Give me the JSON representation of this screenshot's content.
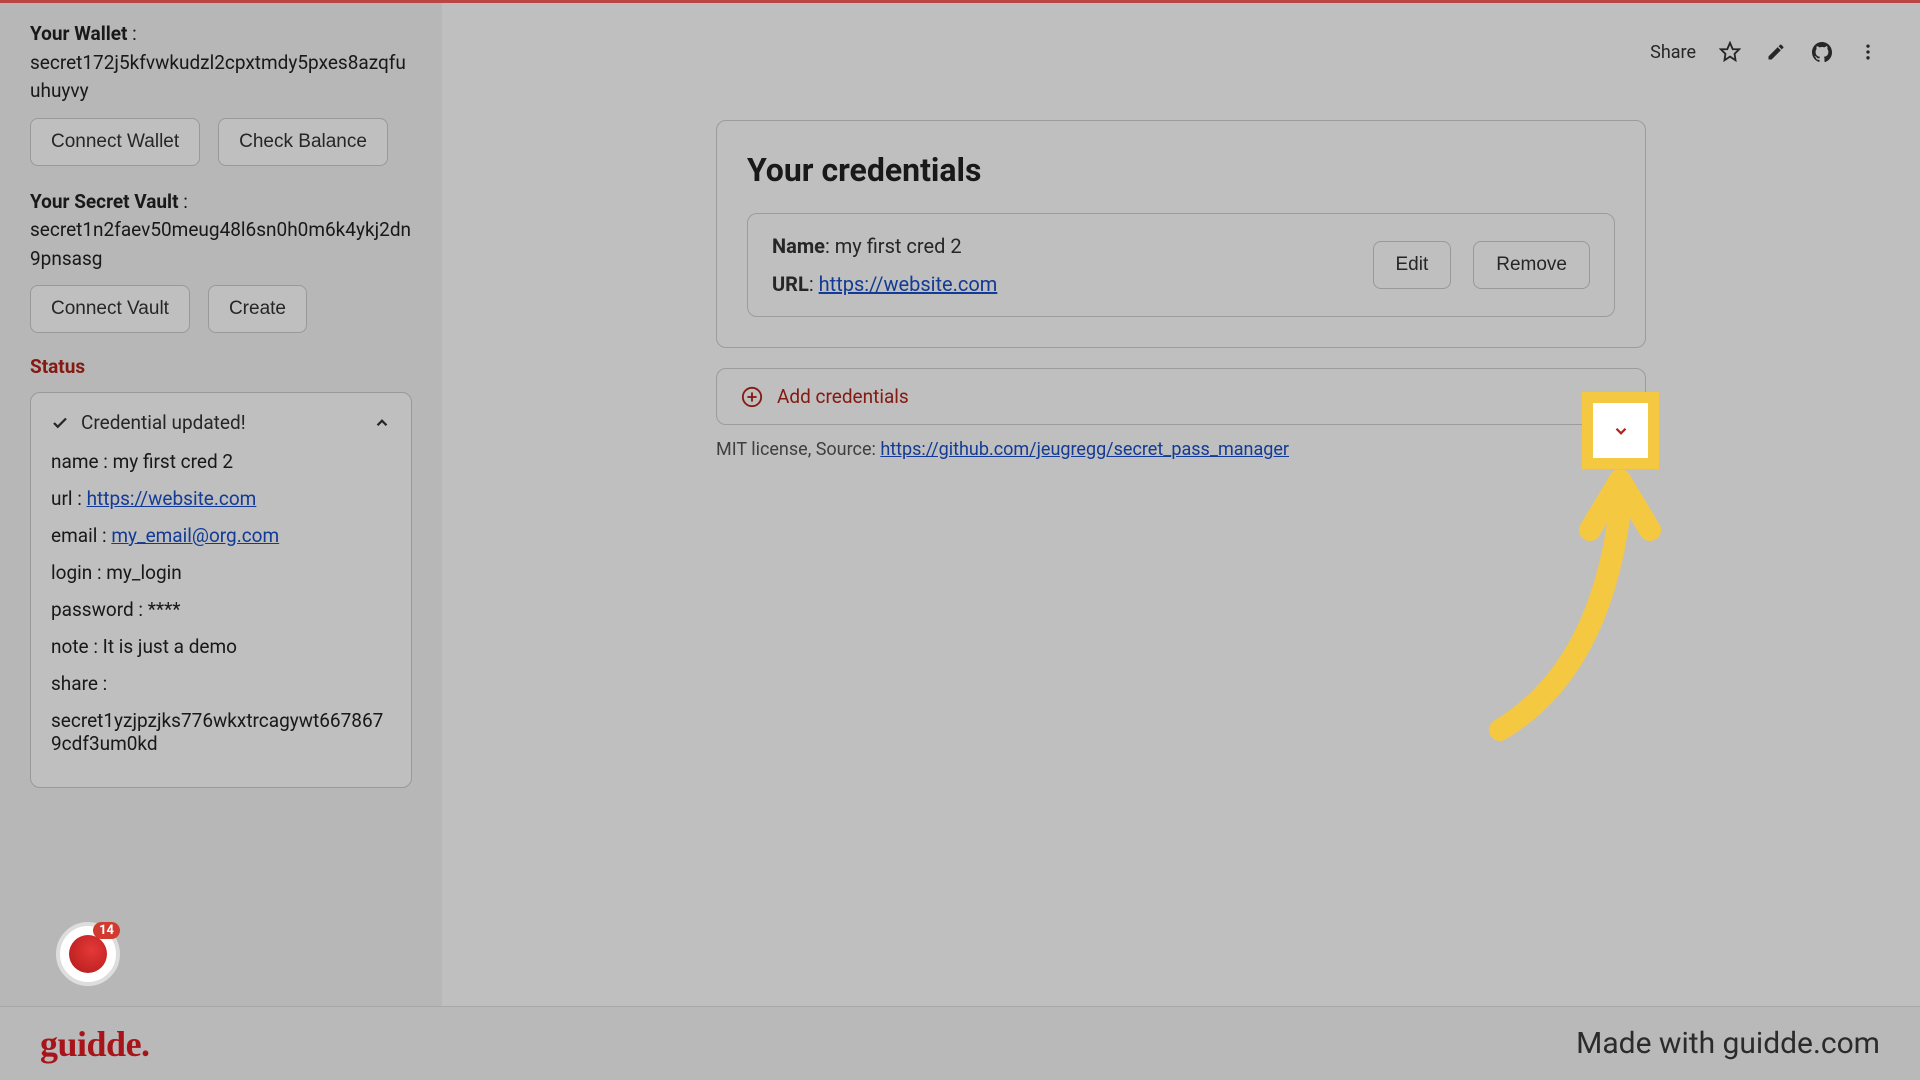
{
  "sidebar": {
    "wallet_label": "Your Wallet",
    "wallet_value": "secret172j5kfvwkudzl2cpxtmdy5pxes8azqfuuhuyvy",
    "connect_wallet": "Connect Wallet",
    "check_balance": "Check Balance",
    "vault_label": "Your Secret Vault",
    "vault_value": "secret1n2faev50meug48l6sn0h0m6k4ykj2dn9pnsasg",
    "connect_vault": "Connect Vault",
    "create": "Create",
    "status_title": "Status",
    "status_header": "Credential updated!",
    "details": {
      "name_label": "name : ",
      "name_value": "my first cred 2",
      "url_label": "url : ",
      "url_value": "https://website.com",
      "email_label": "email : ",
      "email_value": "my_email@org.com",
      "login_label": "login : ",
      "login_value": "my_login",
      "password_label": "password : ",
      "password_value": "****",
      "note_label": "note : ",
      "note_value": "It is just a demo",
      "share_label": "share :",
      "share_value": "secret1yzjpzjks776wkxtrcagywt6678679cdf3um0kd"
    },
    "badge_count": "14"
  },
  "top": {
    "share": "Share"
  },
  "main": {
    "title": "Your credentials",
    "item_name_label": "Name",
    "item_name_value": ": my first cred 2",
    "item_url_label": "URL",
    "item_url_sep": ": ",
    "item_url_value": "https://website.com",
    "edit": "Edit",
    "remove": "Remove",
    "add": "Add credentials",
    "footer_prefix": "MIT license, Source: ",
    "footer_link": "https://github.com/jeugregg/secret_pass_manager"
  },
  "guidde": {
    "logo": "guidde.",
    "tag": "Made with guidde.com"
  }
}
